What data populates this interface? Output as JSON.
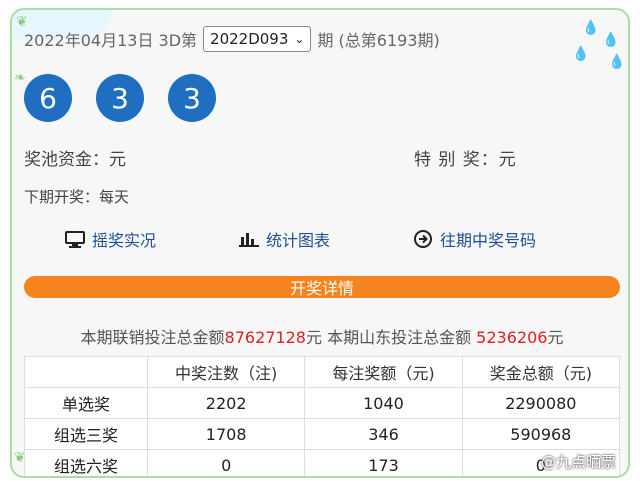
{
  "header": {
    "date_prefix": "2022年04月13日 3D第",
    "issue_select": "2022D093",
    "suffix": "期 (总第6193期)"
  },
  "balls": [
    "6",
    "3",
    "3"
  ],
  "pool": {
    "label": "奖池资金：元"
  },
  "special": {
    "label": "特 别 奖：元"
  },
  "next_draw": {
    "label": "下期开奖：每天"
  },
  "links": [
    {
      "label": "摇奖实况",
      "icon": "monitor-icon"
    },
    {
      "label": "统计图表",
      "icon": "bar-chart-icon"
    },
    {
      "label": "往期中奖号码",
      "icon": "arrow-circle-icon"
    }
  ],
  "detail_button": "开奖详情",
  "totals": {
    "prefix": "本期联销投注总金额",
    "union_amount": "87627128",
    "middle": "元 本期山东投注总金额 ",
    "shandong_amount": "5236206",
    "suffix": "元"
  },
  "table": {
    "headers": [
      "",
      "中奖注数（注)",
      "每注奖额（元)",
      "奖金总额（元)"
    ],
    "rows": [
      [
        "单选奖",
        "2202",
        "1040",
        "2290080"
      ],
      [
        "组选三奖",
        "1708",
        "346",
        "590968"
      ],
      [
        "组选六奖",
        "0",
        "173",
        "0"
      ]
    ]
  },
  "watermark": "@九点晒票",
  "colors": {
    "ball": "#1f6ec0",
    "button": "#f5841f",
    "amount": "#e02020",
    "border": "#a8e0a0"
  }
}
